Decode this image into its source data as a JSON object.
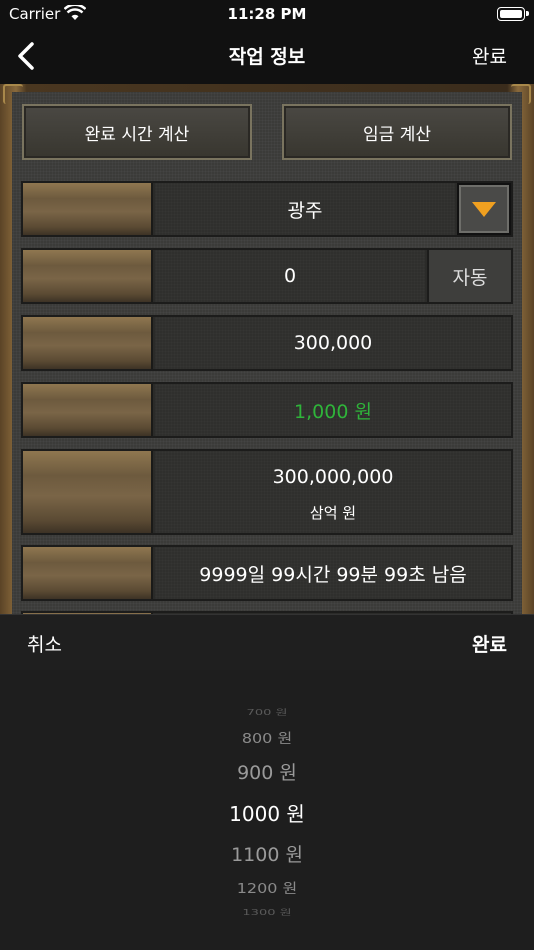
{
  "status_bar": {
    "carrier": "Carrier",
    "time": "11:28 PM"
  },
  "nav": {
    "title": "작업 정보",
    "done_label": "완료"
  },
  "buttons": {
    "finish_time_calc": "완료 시간 계산",
    "wage_calc": "임금 계산"
  },
  "rows": [
    {
      "value": "광주"
    },
    {
      "value": "0",
      "auto_label": "자동"
    },
    {
      "value": "300,000"
    },
    {
      "value": "1,000 원"
    },
    {
      "value": "300,000,000",
      "sub": "삼억 원"
    },
    {
      "value": "9999일 99시간 99분 99초 남음"
    }
  ],
  "toolbar": {
    "cancel_label": "취소",
    "done_label": "완료"
  },
  "picker": {
    "items": [
      "700 원",
      "800 원",
      "900 원",
      "1000 원",
      "1100 원",
      "1200 원",
      "1300 원"
    ],
    "selected": "1000 원"
  },
  "colors": {
    "accent_green": "#2fb43a",
    "dropdown_arrow": "#f0a020"
  }
}
